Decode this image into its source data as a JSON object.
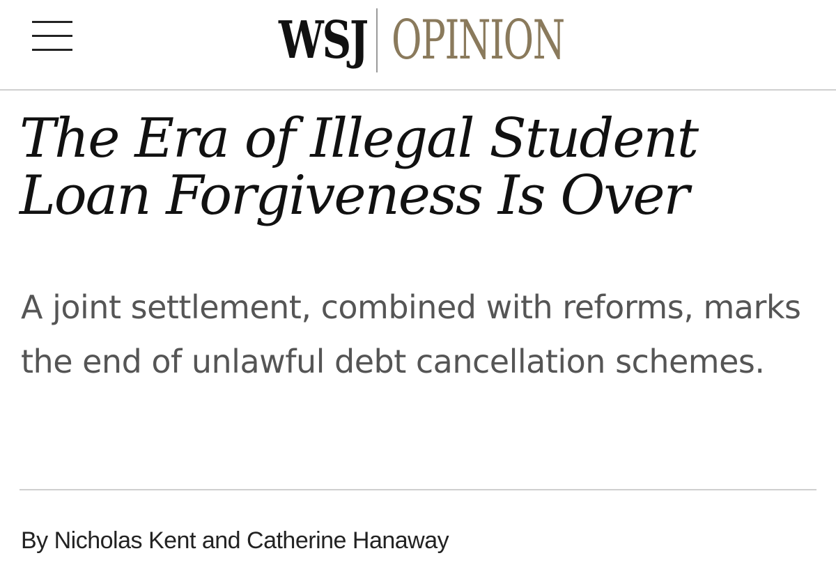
{
  "header": {
    "menu_icon": "hamburger-menu-icon",
    "brand": {
      "publication": "WSJ",
      "section": "OPINION",
      "section_color": "#8a7a5c"
    }
  },
  "article": {
    "headline": "The Era of Illegal Student Loan Forgiveness Is Over",
    "dek": "A joint settlement, combined with reforms, marks the end of unlawful debt cancellation schemes.",
    "byline": "By Nicholas Kent and Catherine Hanaway"
  }
}
